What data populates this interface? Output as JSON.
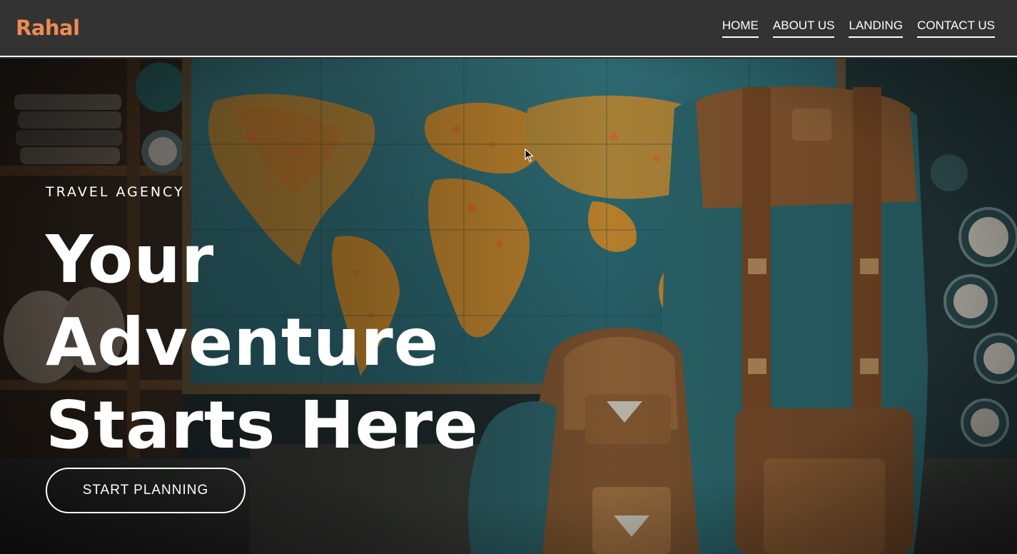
{
  "brand": {
    "name": "Rahal",
    "color": "#ee8a52"
  },
  "nav": {
    "items": [
      {
        "label": "HOME"
      },
      {
        "label": "ABOUT US"
      },
      {
        "label": "LANDING"
      },
      {
        "label": "CONTACT US"
      }
    ]
  },
  "hero": {
    "eyebrow": "TRAVEL AGENCY",
    "headline_lines": [
      "Your",
      "Adventure",
      "Starts Here"
    ],
    "cta_label": "START PLANNING",
    "background": "world-map-and-backpacks-photo"
  },
  "colors": {
    "header_bg": "#333333",
    "text": "#ffffff"
  }
}
